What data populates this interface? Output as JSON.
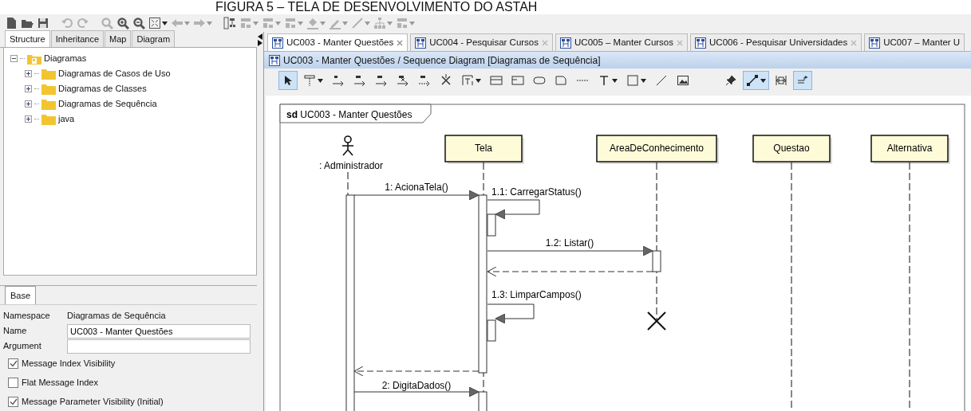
{
  "caption": "FIGURA 5 – TELA DE DESENVOLVIMENTO DO ASTAH",
  "toolbar": [
    {
      "kind": "new",
      "disabled": false
    },
    {
      "kind": "open",
      "disabled": false
    },
    {
      "kind": "save",
      "disabled": false
    },
    {
      "kind": "undo",
      "disabled": true
    },
    {
      "kind": "redo",
      "disabled": true
    },
    {
      "kind": "zoom",
      "disabled": true
    },
    {
      "kind": "zoom-in",
      "disabled": false
    },
    {
      "kind": "zoom-out",
      "disabled": false
    },
    {
      "kind": "fit",
      "disabled": false,
      "dropdown": true
    },
    {
      "kind": "back",
      "disabled": true,
      "dropdown": true
    },
    {
      "kind": "forward",
      "disabled": true,
      "dropdown": true
    },
    {
      "kind": "layout",
      "disabled": false
    },
    {
      "kind": "align-top",
      "disabled": true,
      "dropdown": true
    },
    {
      "kind": "align-left",
      "disabled": true,
      "dropdown": true
    },
    {
      "kind": "arrange",
      "disabled": true,
      "dropdown": true
    },
    {
      "kind": "fill",
      "disabled": true,
      "dropdown": true
    },
    {
      "kind": "pen",
      "disabled": true,
      "dropdown": true
    },
    {
      "kind": "line",
      "disabled": true,
      "dropdown": true
    },
    {
      "kind": "tree",
      "disabled": true,
      "dropdown": true
    },
    {
      "kind": "layout2",
      "disabled": true,
      "dropdown": true
    }
  ],
  "left_tabs": [
    {
      "label": "Structure",
      "selected": true
    },
    {
      "label": "Inheritance",
      "selected": false
    },
    {
      "label": "Map",
      "selected": false
    },
    {
      "label": "Diagram",
      "selected": false
    }
  ],
  "tree": [
    {
      "label": "Diagramas",
      "kind": "project",
      "expanded": true,
      "children": [
        {
          "label": "Diagramas de Casos de Uso",
          "kind": "folder",
          "expanded": false
        },
        {
          "label": "Diagramas de Classes",
          "kind": "folder",
          "expanded": false
        },
        {
          "label": "Diagramas de Sequência",
          "kind": "folder",
          "expanded": false
        },
        {
          "label": "java",
          "kind": "folder",
          "expanded": false
        }
      ]
    }
  ],
  "properties": {
    "tabs": [
      {
        "label": "Base",
        "selected": true
      }
    ],
    "fields": [
      {
        "label": "Namespace",
        "kind": "text",
        "value": "Diagramas de Sequência"
      },
      {
        "label": "Name",
        "kind": "input",
        "value": "UC003 - Manter Questões"
      },
      {
        "label": "Argument",
        "kind": "input"
      }
    ],
    "checkboxes": [
      {
        "label": "Message Index Visibility",
        "checked": true
      },
      {
        "label": "Flat Message Index",
        "checked": false
      },
      {
        "label": "Message Parameter Visibility (Initial)",
        "checked": true
      }
    ]
  },
  "doc_tabs": [
    {
      "label": "UC003 - Manter Questões",
      "selected": true
    },
    {
      "label": "UC004 - Pesquisar Cursos",
      "selected": false
    },
    {
      "label": "UC005 – Manter Cursos",
      "selected": false
    },
    {
      "label": "UC006 - Pesquisar Universidades",
      "selected": false
    },
    {
      "label": "UC007 – Manter U",
      "selected": false
    }
  ],
  "diagram_title": "UC003 - Manter Questões / Sequence Diagram [Diagramas de Sequência]",
  "palette": [
    {
      "kind": "pointer",
      "selected": true
    },
    {
      "kind": "lifeline",
      "selected": false,
      "dropdown": true
    },
    {
      "kind": "sync",
      "selected": false
    },
    {
      "kind": "async",
      "selected": false
    },
    {
      "kind": "create",
      "selected": false
    },
    {
      "kind": "destroy",
      "selected": false
    },
    {
      "kind": "reply",
      "selected": false
    },
    {
      "kind": "stop",
      "selected": false
    },
    {
      "kind": "fragment",
      "selected": false,
      "dropdown": true
    },
    {
      "kind": "frame1",
      "selected": false
    },
    {
      "kind": "frame2",
      "selected": false
    },
    {
      "kind": "oval",
      "selected": false
    },
    {
      "kind": "note",
      "selected": false
    },
    {
      "kind": "dashes",
      "selected": false
    },
    {
      "kind": "text",
      "selected": false,
      "dropdown": true
    },
    {
      "kind": "rect",
      "selected": false,
      "dropdown": true
    },
    {
      "kind": "line",
      "selected": false
    },
    {
      "kind": "image",
      "selected": false
    },
    {
      "kind": "pin",
      "selected": false
    },
    {
      "kind": "connector",
      "selected": true,
      "dropdown": true
    },
    {
      "kind": "fitwidth",
      "selected": false
    },
    {
      "kind": "route",
      "selected": true
    }
  ],
  "diagram": {
    "frame_keyword": "sd",
    "frame_name": "UC003 - Manter Questões",
    "participants": [
      {
        "label": ": Administrador",
        "kind": "actor"
      },
      {
        "label": "Tela",
        "kind": "object"
      },
      {
        "label": "AreaDeConhecimento",
        "kind": "object"
      },
      {
        "label": "Questao",
        "kind": "object"
      },
      {
        "label": "Alternativa",
        "kind": "object"
      }
    ],
    "messages": [
      {
        "label": "1: AcionaTela()",
        "kind": "call"
      },
      {
        "label": "1.1: CarregarStatus()",
        "kind": "self"
      },
      {
        "label": "1.2: Listar()",
        "kind": "call"
      },
      {
        "kind": "return"
      },
      {
        "label": "1.3: LimparCampos()",
        "kind": "self"
      },
      {
        "kind": "destroy"
      },
      {
        "kind": "return"
      },
      {
        "label": "2: DigitaDados()",
        "kind": "call"
      }
    ]
  }
}
